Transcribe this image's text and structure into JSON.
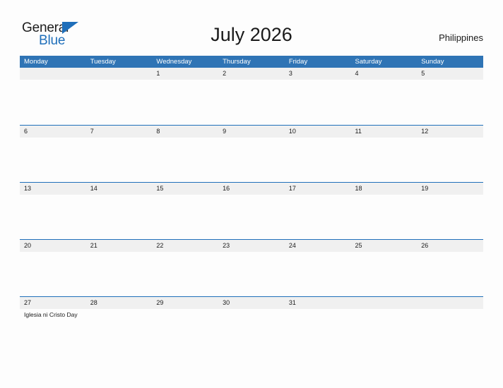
{
  "brand": {
    "name_part1": "General",
    "name_part2": "Blue",
    "triangle_color": "#1f6fba",
    "text_color": "#1c1c1c"
  },
  "header": {
    "title": "July 2026",
    "region": "Philippines"
  },
  "theme": {
    "header_blue": "#2f74b5",
    "row_divider_blue": "#1f6fba",
    "band_gray": "#f0f0f0",
    "page_background": "#fdfdfd",
    "text_color": "#1a1a1a"
  },
  "calendar": {
    "month": "July",
    "year": "2026",
    "weekdays": [
      "Monday",
      "Tuesday",
      "Wednesday",
      "Thursday",
      "Friday",
      "Saturday",
      "Sunday"
    ],
    "weeks": [
      [
        {
          "date": "",
          "events": []
        },
        {
          "date": "",
          "events": []
        },
        {
          "date": "1",
          "events": []
        },
        {
          "date": "2",
          "events": []
        },
        {
          "date": "3",
          "events": []
        },
        {
          "date": "4",
          "events": []
        },
        {
          "date": "5",
          "events": []
        }
      ],
      [
        {
          "date": "6",
          "events": []
        },
        {
          "date": "7",
          "events": []
        },
        {
          "date": "8",
          "events": []
        },
        {
          "date": "9",
          "events": []
        },
        {
          "date": "10",
          "events": []
        },
        {
          "date": "11",
          "events": []
        },
        {
          "date": "12",
          "events": []
        }
      ],
      [
        {
          "date": "13",
          "events": []
        },
        {
          "date": "14",
          "events": []
        },
        {
          "date": "15",
          "events": []
        },
        {
          "date": "16",
          "events": []
        },
        {
          "date": "17",
          "events": []
        },
        {
          "date": "18",
          "events": []
        },
        {
          "date": "19",
          "events": []
        }
      ],
      [
        {
          "date": "20",
          "events": []
        },
        {
          "date": "21",
          "events": []
        },
        {
          "date": "22",
          "events": []
        },
        {
          "date": "23",
          "events": []
        },
        {
          "date": "24",
          "events": []
        },
        {
          "date": "25",
          "events": []
        },
        {
          "date": "26",
          "events": []
        }
      ],
      [
        {
          "date": "27",
          "events": [
            "Iglesia ni Cristo Day"
          ]
        },
        {
          "date": "28",
          "events": []
        },
        {
          "date": "29",
          "events": []
        },
        {
          "date": "30",
          "events": []
        },
        {
          "date": "31",
          "events": []
        },
        {
          "date": "",
          "events": []
        },
        {
          "date": "",
          "events": []
        }
      ]
    ]
  }
}
